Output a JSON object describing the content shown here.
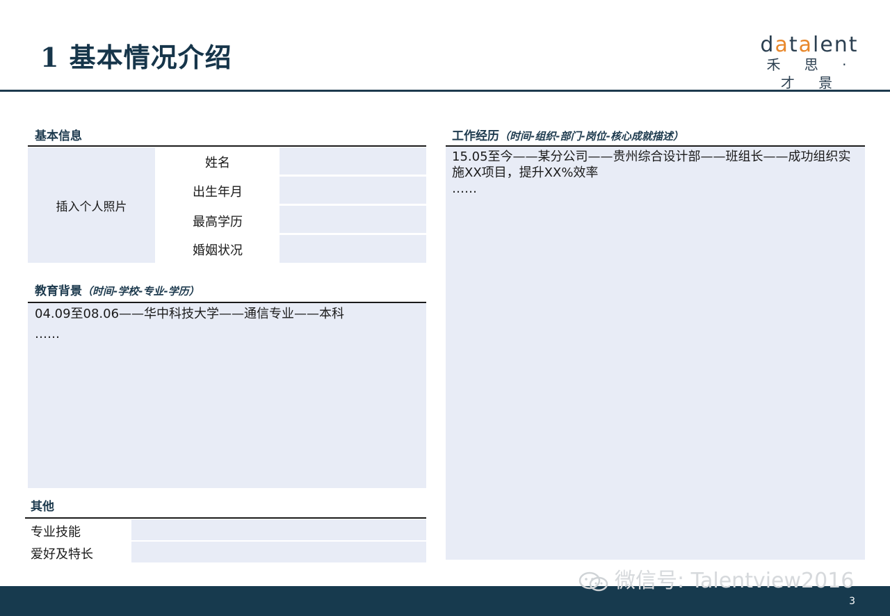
{
  "slide": {
    "title": "1 基本情况介绍",
    "page_number": "3"
  },
  "logo": {
    "wordmark_pre": "d",
    "wordmark_a1": "a",
    "wordmark_mid": "t",
    "wordmark_a2": "a",
    "wordmark_post": "lent",
    "chinese": "禾 思 · 才 景",
    "accent_color": "#e8872a"
  },
  "basic_info": {
    "heading": "基本信息",
    "photo_placeholder": "插入个人照片",
    "fields": [
      {
        "label": "姓名",
        "value": ""
      },
      {
        "label": "出生年月",
        "value": ""
      },
      {
        "label": "最高学历",
        "value": ""
      },
      {
        "label": "婚姻状况",
        "value": ""
      }
    ]
  },
  "education": {
    "heading": "教育背景",
    "subheading": "（时间-学校-专业-学历）",
    "line1": "04.09至08.06——华中科技大学——通信专业——本科",
    "line2": "……"
  },
  "others": {
    "heading": "其他",
    "fields": [
      {
        "label": "专业技能",
        "value": ""
      },
      {
        "label": "爱好及特长",
        "value": ""
      }
    ]
  },
  "work": {
    "heading": "工作经历",
    "subheading": "（时间-组织-部门-岗位-核心成就描述）",
    "line1": "15.05至今——某分公司——贵州综合设计部——班组长——成功组织实",
    "line2": "施XX项目，提升XX%效率",
    "line3": "……"
  },
  "watermark": {
    "text": "微信号: Talentview2016"
  },
  "colors": {
    "primary": "#1d3a4e",
    "panel": "#e8ecf6",
    "footer": "#173a4e"
  }
}
